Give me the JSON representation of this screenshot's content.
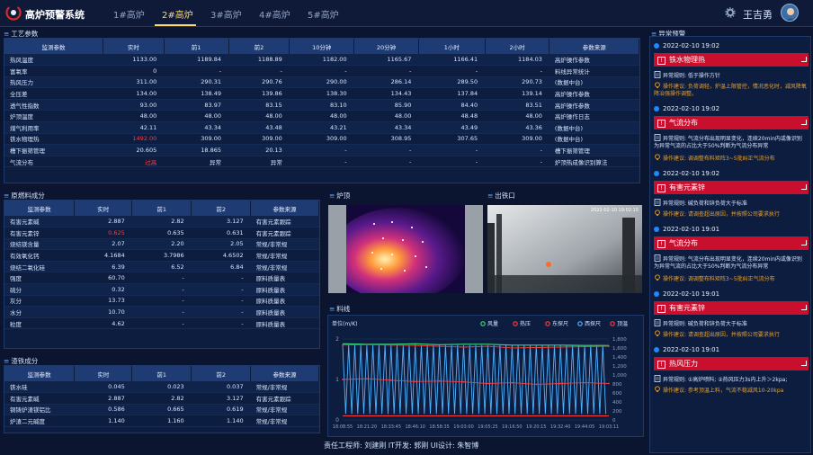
{
  "header": {
    "title": "高炉预警系统",
    "tabs": [
      "1#高炉",
      "2#高炉",
      "3#高炉",
      "4#高炉",
      "5#高炉"
    ],
    "user": "王吉勇"
  },
  "process": {
    "title": "工艺参数",
    "headers": [
      "监测参数",
      "实时",
      "前1",
      "前2",
      "10分钟",
      "20分钟",
      "1小时",
      "2小时",
      "参数来源"
    ],
    "rows": [
      [
        "热风温度",
        "1133.00",
        "1189.84",
        "1188.89",
        "1182.00",
        "1165.67",
        "1166.41",
        "1184.03",
        "高炉操作参数"
      ],
      [
        "富氧率",
        "0",
        "-",
        "-",
        "-",
        "-",
        "-",
        "-",
        "料线异常统计"
      ],
      [
        "热风压力",
        "311.00",
        "290.31",
        "290.76",
        "290.00",
        "286.14",
        "289.50",
        "290.73",
        "(数据中台)"
      ],
      [
        "全压差",
        "134.00",
        "138.49",
        "139.86",
        "138.30",
        "134.43",
        "137.84",
        "139.14",
        "高炉操作参数"
      ],
      [
        "透气性指数",
        "93.00",
        "83.97",
        "83.15",
        "83.10",
        "85.90",
        "84.40",
        "83.51",
        "高炉操作参数"
      ],
      [
        "炉顶温度",
        "48.00",
        "48.00",
        "48.00",
        "48.00",
        "48.00",
        "48.48",
        "48.00",
        "高炉操作日志"
      ],
      [
        "煤气利用率",
        "42.11",
        "43.34",
        "43.48",
        "43.21",
        "43.34",
        "43.49",
        "43.36",
        "(数据中台)"
      ],
      [
        "铁水物理热",
        "1492.00",
        "309.00",
        "309.00",
        "309.00",
        "308.95",
        "307.65",
        "309.00",
        "(数据中台)"
      ],
      [
        "槽下振筛管理",
        "20.605",
        "18.865",
        "20.13",
        "-",
        "-",
        "-",
        "-",
        "槽下振筛管理"
      ],
      [
        "气流分布",
        "过高",
        "异常",
        "异常",
        "-",
        "-",
        "-",
        "-",
        "炉顶热成像识别算法"
      ]
    ]
  },
  "raw": {
    "title": "原燃料成分",
    "headers": [
      "监测参数",
      "实时",
      "前1",
      "前2",
      "参数来源"
    ],
    "rows": [
      [
        "有害元素碱",
        "2.887",
        "2.82",
        "3.127",
        "有害元素跟踪"
      ],
      [
        "有害元素锌",
        "0.625",
        "0.635",
        "0.631",
        "有害元素跟踪"
      ],
      [
        "烧结镁含量",
        "2.07",
        "2.20",
        "2.05",
        "常规/非常规"
      ],
      [
        "有效氧化钙",
        "4.1684",
        "3.7986",
        "4.6502",
        "常规/非常规"
      ],
      [
        "烧结二氧化硅",
        "6.39",
        "6.52",
        "6.84",
        "常规/非常规"
      ],
      [
        "强度",
        "60.70",
        "-",
        "-",
        "原料质量表"
      ],
      [
        "硫分",
        "0.32",
        "-",
        "-",
        "原料质量表"
      ],
      [
        "灰分",
        "13.73",
        "-",
        "-",
        "原料质量表"
      ],
      [
        "水分",
        "10.70",
        "-",
        "-",
        "原料质量表"
      ],
      [
        "粒度",
        "4.62",
        "-",
        "-",
        "原料质量表"
      ]
    ]
  },
  "slag": {
    "title": "渣铁成分",
    "headers": [
      "监测参数",
      "实时",
      "前1",
      "前2",
      "参数来源"
    ],
    "rows": [
      [
        "铁水硅",
        "0.045",
        "0.023",
        "0.037",
        "常规/非常规"
      ],
      [
        "有害元素碱",
        "2.887",
        "2.82",
        "3.127",
        "有害元素跟踪"
      ],
      [
        "铜铸炉渣镁铝比",
        "0.586",
        "0.665",
        "0.619",
        "常规/非常规"
      ],
      [
        "炉渣二元碱度",
        "1.140",
        "1.160",
        "1.140",
        "常规/非常规"
      ]
    ]
  },
  "cams": {
    "top": "炉顶",
    "tap": "出铁口",
    "tap_time": "2022-02-10 19:02:15"
  },
  "chart": {
    "title": "料线",
    "unit": "单位(m/K)"
  },
  "chart_data": {
    "type": "line",
    "legend": [
      "风量",
      "热压",
      "东探尺",
      "西探尺",
      "顶温"
    ],
    "colors": [
      "#37d67a",
      "#ff3b3b",
      "#ff3b3b",
      "#4fb3ff",
      "#ff3b3b"
    ],
    "yleft": [
      0,
      1,
      2
    ],
    "yright": [
      0,
      200,
      400,
      600,
      800,
      1000,
      1200,
      1400,
      1600,
      1800
    ],
    "x": [
      "18:08:55",
      "18:21:20",
      "18:33:45",
      "18:46:10",
      "18:58:35",
      "19:03:00",
      "19:05:25",
      "19:16:50",
      "19:20:15",
      "19:32:40",
      "19:44:05",
      "19:03:11"
    ],
    "series": [
      {
        "name": "风量",
        "values": [
          1.88,
          1.87,
          1.87,
          1.88,
          1.86,
          1.87,
          1.87,
          1.85,
          1.85,
          1.85,
          1.84,
          1.84
        ]
      },
      {
        "name": "热压",
        "values": [
          1.85,
          1.86,
          1.85,
          1.84,
          1.82,
          1.8,
          1.82,
          1.78,
          1.79,
          1.8,
          1.81,
          1.82
        ]
      },
      {
        "name": "东探尺",
        "values": [
          1.0,
          1.02,
          0.98,
          0.95,
          0.96,
          0.94,
          0.9,
          0.92,
          0.88,
          0.9,
          0.92,
          0.9
        ]
      },
      {
        "name": "西探尺",
        "values": [
          0.2,
          1.8,
          0.3,
          1.7,
          0.2,
          1.8,
          0.3,
          1.7,
          0.2,
          1.8,
          0.3,
          1.6
        ]
      },
      {
        "name": "顶温",
        "values": [
          0.1,
          0.1,
          0.1,
          0.1,
          0.1,
          0.1,
          0.1,
          0.1,
          0.1,
          0.1,
          0.1,
          0.1
        ]
      }
    ]
  },
  "alarm": {
    "title": "异常预警",
    "items": [
      {
        "time": "2022-02-10 19:02",
        "type": "铁水物理热",
        "rule": "异常规则: 低于操作方针",
        "sug": "操作建议: 负荷调轻，炉温上限管控，情况恶化时，减风降氧降冶强操作调整。"
      },
      {
        "time": "2022-02-10 19:02",
        "type": "气流分布",
        "rule": "异常规则: 气流分布出现明显变化，连续20min内或像识别为异常气流的占比大于50%判断为气流分布异常",
        "sug": "操作建议: 调调整布料矩阵3~5批纠正气流分布"
      },
      {
        "time": "2022-02-10 19:02",
        "type": "有害元素锌",
        "rule": "异常规则: 碱负荷和锌负荷大于标准",
        "sug": "操作建议: 请调查超出原因，并按照公司要求执行"
      },
      {
        "time": "2022-02-10 19:01",
        "type": "气流分布",
        "rule": "异常规则: 气流分布出现明显变化，连续20min内或像识别为异常气流的占比大于50%判断为气流分布异常",
        "sug": "操作建议: 调调整布料矩阵3~5批纠正气流分布"
      },
      {
        "time": "2022-02-10 19:01",
        "type": "有害元素锌",
        "rule": "异常规则: 碱负荷和锌负荷大于标准",
        "sug": "操作建议: 请调查超出原因，并按照公司要求执行"
      },
      {
        "time": "2022-02-10 19:01",
        "type": "热风压力",
        "rule": "异常规则: ①高炉喷料; ②热风压力3s内上升＞2kpa;",
        "sug": "操作建议: 参考顶温上料，气流不稳减风10-20kpa"
      }
    ]
  },
  "footer": "责任工程师: 刘建刚 IT开发: 郭刚 UI设计: 朱智博"
}
